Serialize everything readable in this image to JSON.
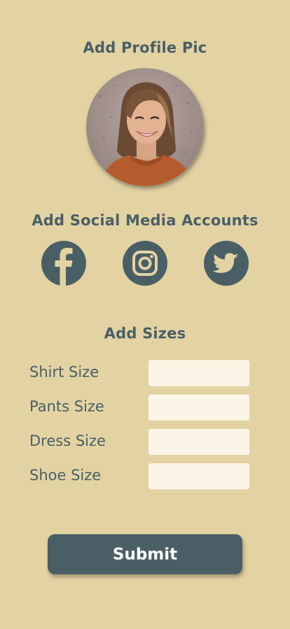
{
  "profile": {
    "title": "Add Profile Pic"
  },
  "social": {
    "title": "Add Social Media Accounts",
    "accounts": [
      {
        "icon": "facebook-icon"
      },
      {
        "icon": "instagram-icon"
      },
      {
        "icon": "twitter-icon"
      }
    ]
  },
  "sizes": {
    "title": "Add Sizes",
    "fields": [
      {
        "label": "Shirt Size",
        "value": ""
      },
      {
        "label": "Pants Size",
        "value": ""
      },
      {
        "label": "Dress Size",
        "value": ""
      },
      {
        "label": "Shoe Size",
        "value": ""
      }
    ]
  },
  "submit_label": "Submit",
  "colors": {
    "background": "#e3d3a3",
    "accent": "#4a5f65",
    "input_background": "#faf5e6"
  }
}
